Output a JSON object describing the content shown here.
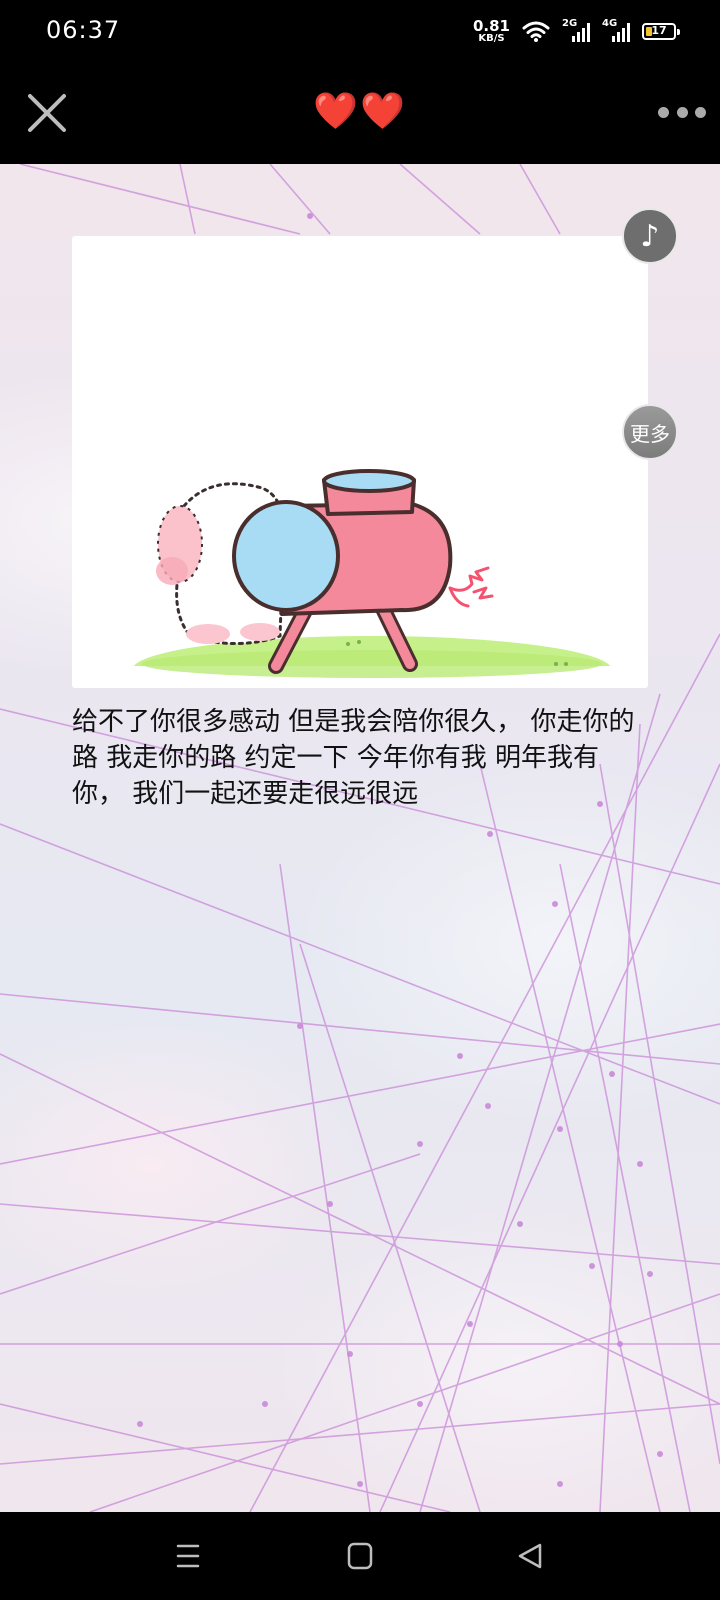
{
  "status_bar": {
    "time": "06:37",
    "net_speed_value": "0.81",
    "net_speed_unit": "KB/S",
    "sim1_type": "2G",
    "sim2_type": "4G",
    "battery_level": "17"
  },
  "header": {
    "title": "❤️❤️",
    "close_icon": "close-icon",
    "more_icon": "more-dots-icon"
  },
  "side_buttons": {
    "music_icon": "music-note-icon",
    "more_label": "更多"
  },
  "post": {
    "image": "cartoon-bunny-pushing-pink-barrel",
    "text": "给不了你很多感动 但是我会陪你很久， 你走你的路 我走你的路 约定一下 今年你有我 明年我有你， 我们一起还要走很远很远"
  },
  "nav_bar": {
    "menu_icon": "menu-icon",
    "home_icon": "home-icon",
    "back_icon": "back-icon"
  },
  "colors": {
    "background_tint": "#ece6ee",
    "web_lines": "#c98ad8",
    "heart": "#e02828"
  }
}
